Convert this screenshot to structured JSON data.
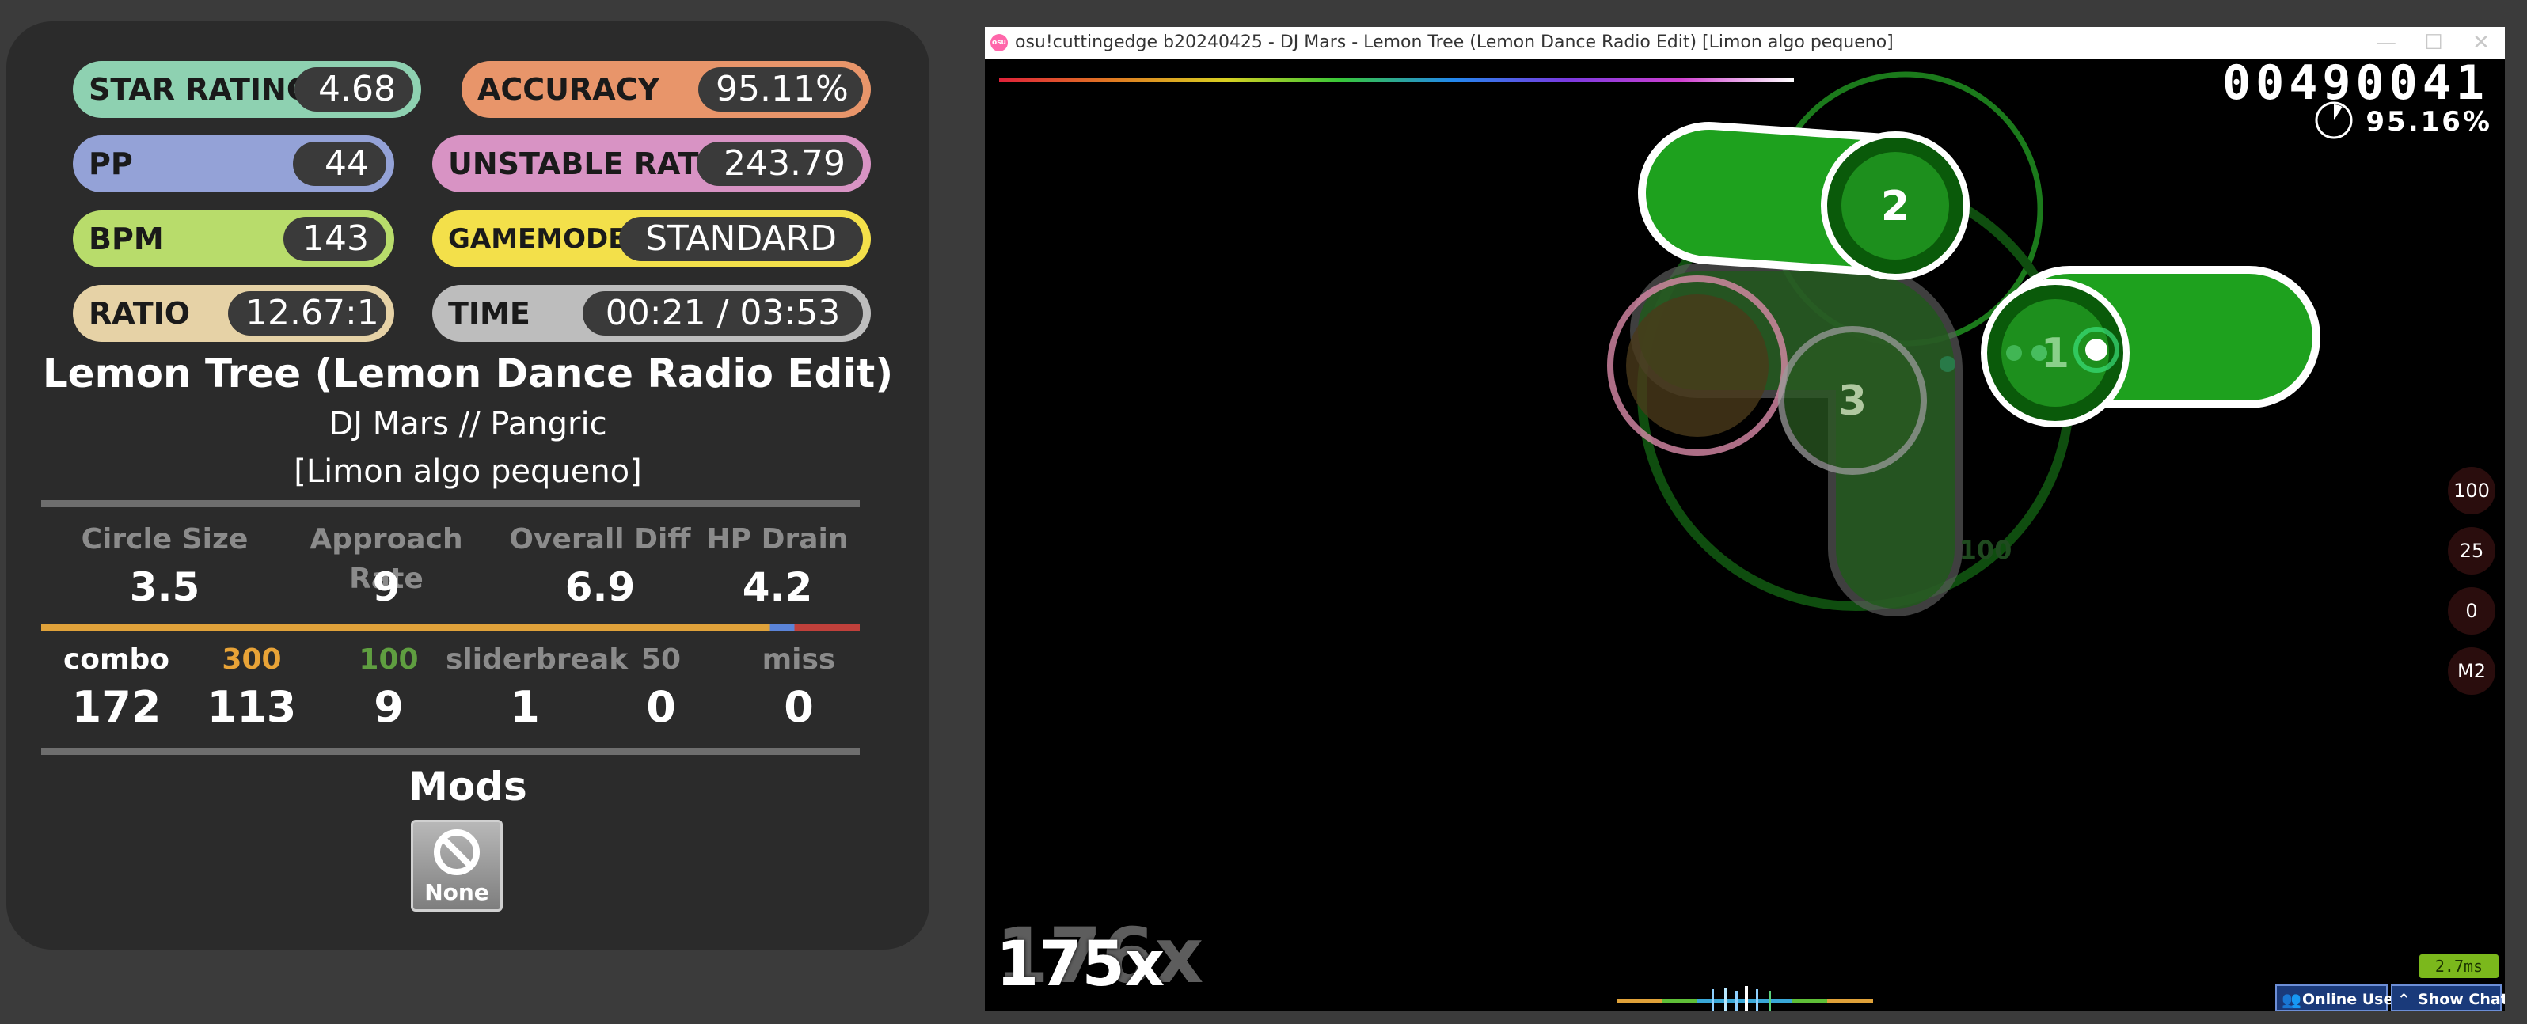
{
  "panel": {
    "stats": {
      "star_rating": {
        "label": "STAR RATING",
        "value": "4.68"
      },
      "accuracy": {
        "label": "ACCURACY",
        "value": "95.11%"
      },
      "pp": {
        "label": "PP",
        "value": "44"
      },
      "unstable_rate": {
        "label": "UNSTABLE RATE",
        "value": "243.79"
      },
      "bpm": {
        "label": "BPM",
        "value": "143"
      },
      "gamemode": {
        "label": "GAMEMODE",
        "value": "STANDARD"
      },
      "ratio": {
        "label": "RATIO",
        "value": "12.67:1"
      },
      "time": {
        "label": "TIME",
        "value": "00:21 / 03:53"
      }
    },
    "colors": {
      "star_rating": "#8ed1b1",
      "accuracy": "#e8956a",
      "pp": "#94a2d7",
      "unstable_rate": "#d893c4",
      "bpm": "#b8dc6b",
      "gamemode": "#f3e04a",
      "ratio": "#e6d2a6",
      "time": "#bdbdbd"
    },
    "song_title": "Lemon Tree (Lemon Dance Radio Edit)",
    "artist_mapper": "DJ Mars // Pangric",
    "difficulty": "[Limon algo pequeno]",
    "map_stats": [
      {
        "label": "Circle Size",
        "value": "3.5"
      },
      {
        "label": "Approach Rate",
        "value": "9"
      },
      {
        "label": "Overall Diff",
        "value": "6.9"
      },
      {
        "label": "HP Drain",
        "value": "4.2"
      }
    ],
    "judgements": [
      {
        "label": "combo",
        "value": "172",
        "color": "#ffffff"
      },
      {
        "label": "300",
        "value": "113",
        "color": "#e8a337"
      },
      {
        "label": "100",
        "value": "9",
        "color": "#5f9e40"
      },
      {
        "label": "sliderbreak",
        "value": "1",
        "color": "#8b8b8b"
      },
      {
        "label": "50",
        "value": "0",
        "color": "#8b8b8b"
      },
      {
        "label": "miss",
        "value": "0",
        "color": "#8b8b8b"
      }
    ],
    "mods_heading": "Mods",
    "mod_none_label": "None"
  },
  "game": {
    "window_title": "osu!cuttingedge b20240425 - DJ Mars - Lemon Tree (Lemon Dance Radio Edit) [Limon algo pequeno]",
    "logo_text": "osu",
    "score": "00490041",
    "accuracy": "95.16%",
    "hit_counters": [
      "100",
      "25",
      "0",
      "M2"
    ],
    "combo": "175x",
    "combo_ghost": "176x",
    "hit_numbers": [
      "2",
      "3",
      "1"
    ],
    "hit_label_100": "100",
    "frame_time": "2.7ms",
    "online_users_label": "Online Users",
    "show_chat_label": "Show Chat",
    "song_progress": 0.09
  }
}
